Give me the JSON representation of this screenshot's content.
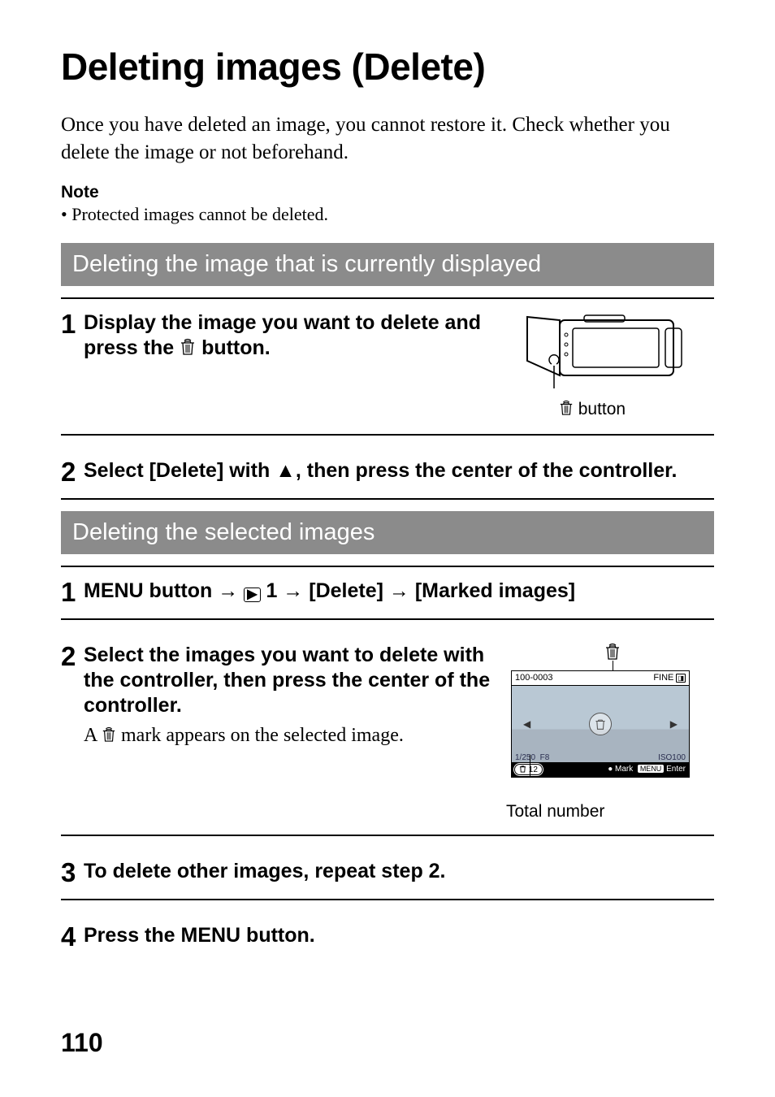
{
  "title": "Deleting images (Delete)",
  "intro": "Once you have deleted an image, you cannot restore it. Check whether you delete the image or not beforehand.",
  "note_head": "Note",
  "note_body": "• Protected images cannot be deleted.",
  "section1": "Deleting the image that is currently displayed",
  "s1_step1_a": "Display the image you want to delete and press the ",
  "s1_step1_b": " button.",
  "s1_diagram_label_suffix": " button",
  "s1_step2": "Select [Delete] with ▲, then press the center of the controller.",
  "section2": "Deleting the selected images",
  "s2_step1_a": "MENU button → ",
  "s2_step1_b": " 1 → [Delete] → [Marked images]",
  "s2_step2_main": "Select the images you want to delete with the controller, then press the center of the controller.",
  "s2_step2_sub_a": "A ",
  "s2_step2_sub_b": " mark appears on the selected image.",
  "screen": {
    "file": "100-0003",
    "quality": "FINE",
    "shutter": "1/250",
    "aperture": "F8",
    "iso": "ISO100",
    "count": "12",
    "mark": "Mark",
    "enter": "Enter",
    "menu": "MENU"
  },
  "total_number": "Total number",
  "s2_step3": "To delete other images, repeat step 2.",
  "s2_step4": "Press the MENU button.",
  "page_number": "110"
}
